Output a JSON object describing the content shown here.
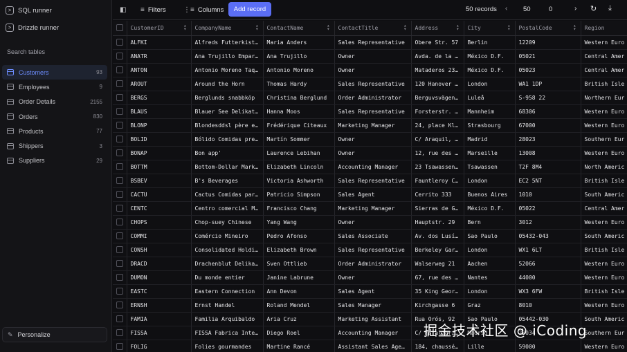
{
  "sidebar": {
    "sql_runner": "SQL runner",
    "drizzle_runner": "Drizzle runner",
    "search_label": "Search tables",
    "tables": [
      {
        "name": "Customers",
        "count": "93"
      },
      {
        "name": "Employees",
        "count": "9"
      },
      {
        "name": "Order Details",
        "count": "2155"
      },
      {
        "name": "Orders",
        "count": "830"
      },
      {
        "name": "Products",
        "count": "77"
      },
      {
        "name": "Shippers",
        "count": "3"
      },
      {
        "name": "Suppliers",
        "count": "29"
      }
    ],
    "personalize": "Personalize"
  },
  "toolbar": {
    "filters": "Filters",
    "columns": "Columns",
    "add_record": "Add record",
    "records": "50 records",
    "limit": "50",
    "offset": "0"
  },
  "grid": {
    "columns": [
      "CustomerID",
      "CompanyName",
      "ContactName",
      "ContactTitle",
      "Address",
      "City",
      "PostalCode",
      "Region"
    ],
    "rows": [
      [
        "ALFKI",
        "Alfreds Futterkist…",
        "Maria Anders",
        "Sales Representative",
        "Obere Str. 57",
        "Berlin",
        "12209",
        "Western Euro"
      ],
      [
        "ANATR",
        "Ana Trujillo Empar…",
        "Ana Trujillo",
        "Owner",
        "Avda. de la …",
        "México D.F.",
        "05021",
        "Central Amer"
      ],
      [
        "ANTON",
        "Antonio Moreno Taq…",
        "Antonio Moreno",
        "Owner",
        "Mataderos 23…",
        "México D.F.",
        "05023",
        "Central Amer"
      ],
      [
        "AROUT",
        "Around the Horn",
        "Thomas Hardy",
        "Sales Representative",
        "120 Hanover …",
        "London",
        "WA1 1DP",
        "British Isle"
      ],
      [
        "BERGS",
        "Berglunds snabbköp",
        "Christina Berglund",
        "Order Administrator",
        "Berguvsvägen…",
        "Luleå",
        "S-958 22",
        "Northern Eur"
      ],
      [
        "BLAUS",
        "Blauer See Delikat…",
        "Hanna Moos",
        "Sales Representative",
        "Forsterstr. …",
        "Mannheim",
        "68306",
        "Western Euro"
      ],
      [
        "BLONP",
        "Blondesddsl père e…",
        "Frédérique Citeaux",
        "Marketing Manager",
        "24, place Kl…",
        "Strasbourg",
        "67000",
        "Western Euro"
      ],
      [
        "BOLID",
        "Bólido Comidas pre…",
        "Martín Sommer",
        "Owner",
        "C/ Araquil, …",
        "Madrid",
        "28023",
        "Southern Eur"
      ],
      [
        "BONAP",
        "Bon app'",
        "Laurence Lebihan",
        "Owner",
        "12, rue des …",
        "Marseille",
        "13008",
        "Western Euro"
      ],
      [
        "BOTTM",
        "Bottom-Dollar Mark…",
        "Elizabeth Lincoln",
        "Accounting Manager",
        "23 Tsawassen…",
        "Tsawassen",
        "T2F 8M4",
        "North Americ"
      ],
      [
        "BSBEV",
        "B's Beverages",
        "Victoria Ashworth",
        "Sales Representative",
        "Fauntleroy C…",
        "London",
        "EC2 5NT",
        "British Isle"
      ],
      [
        "CACTU",
        "Cactus Comidas par…",
        "Patricio Simpson",
        "Sales Agent",
        "Cerrito 333",
        "Buenos Aires",
        "1010",
        "South Americ"
      ],
      [
        "CENTC",
        "Centro comercial M…",
        "Francisco Chang",
        "Marketing Manager",
        "Sierras de G…",
        "México D.F.",
        "05022",
        "Central Amer"
      ],
      [
        "CHOPS",
        "Chop-suey Chinese",
        "Yang Wang",
        "Owner",
        "Hauptstr. 29",
        "Bern",
        "3012",
        "Western Euro"
      ],
      [
        "COMMI",
        "Comércio Mineiro",
        "Pedro Afonso",
        "Sales Associate",
        "Av. dos Lusí…",
        "Sao Paulo",
        "05432-043",
        "South Americ"
      ],
      [
        "CONSH",
        "Consolidated Holdi…",
        "Elizabeth Brown",
        "Sales Representative",
        "Berkeley Gar…",
        "London",
        "WX1 6LT",
        "British Isle"
      ],
      [
        "DRACD",
        "Drachenblut Delika…",
        "Sven Ottlieb",
        "Order Administrator",
        "Walserweg 21",
        "Aachen",
        "52066",
        "Western Euro"
      ],
      [
        "DUMON",
        "Du monde entier",
        "Janine Labrune",
        "Owner",
        "67, rue des …",
        "Nantes",
        "44000",
        "Western Euro"
      ],
      [
        "EASTC",
        "Eastern Connection",
        "Ann Devon",
        "Sales Agent",
        "35 King Geor…",
        "London",
        "WX3 6FW",
        "British Isle"
      ],
      [
        "ERNSH",
        "Ernst Handel",
        "Roland Mendel",
        "Sales Manager",
        "Kirchgasse 6",
        "Graz",
        "8010",
        "Western Euro"
      ],
      [
        "FAMIA",
        "Familia Arquibaldo",
        "Aria Cruz",
        "Marketing Assistant",
        "Rua Orós, 92",
        "Sao Paulo",
        "05442-030",
        "South Americ"
      ],
      [
        "FISSA",
        "FISSA Fabrica Inte…",
        "Diego Roel",
        "Accounting Manager",
        "C/ Moralzarz…",
        "Madrid",
        "28034",
        "Southern Eur"
      ],
      [
        "FOLIG",
        "Folies gourmandes",
        "Martine Rancé",
        "Assistant Sales Age…",
        "184, chaussé…",
        "Lille",
        "59000",
        "Western Euro"
      ]
    ]
  },
  "watermark": "掘金技术社区 @ iCoding"
}
